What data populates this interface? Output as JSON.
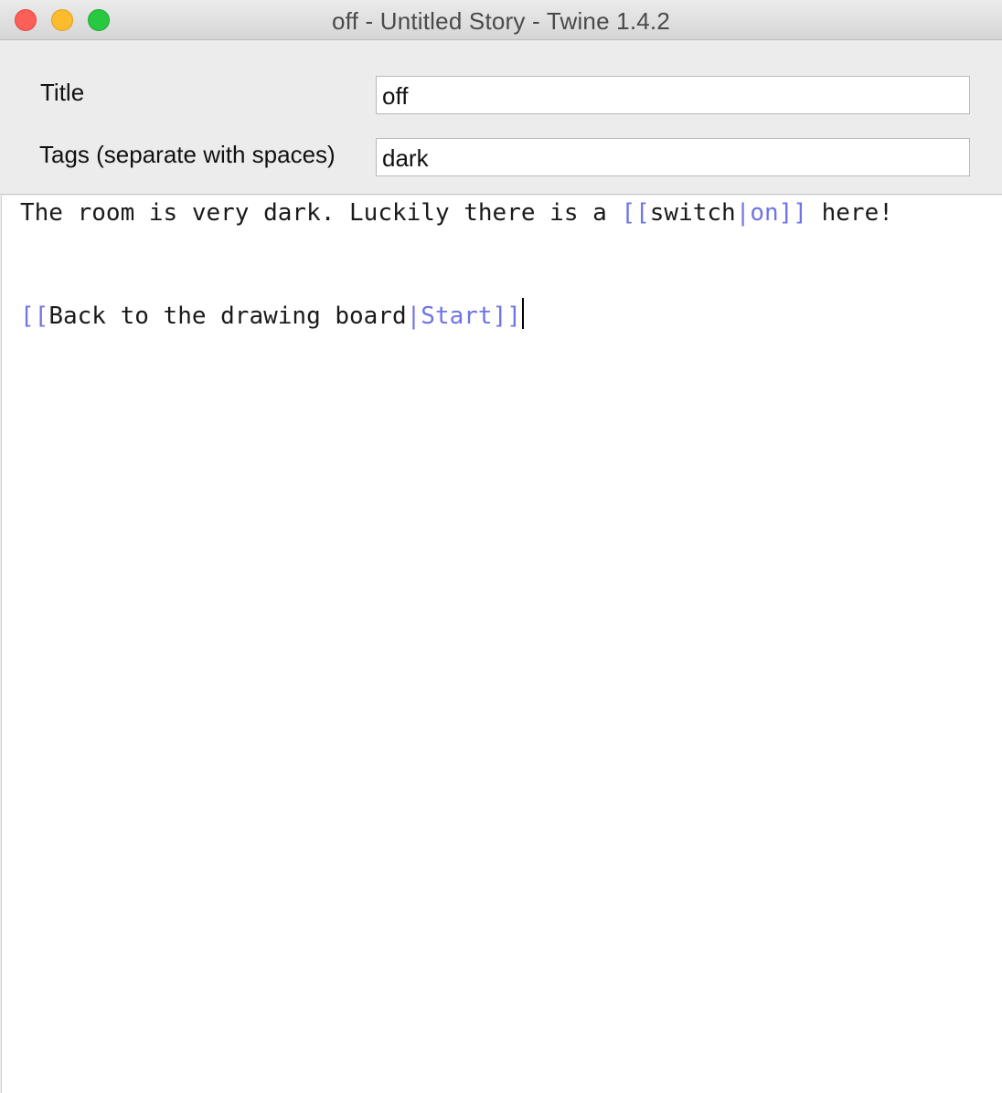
{
  "window": {
    "title": "off - Untitled Story - Twine 1.4.2"
  },
  "form": {
    "title_label": "Title",
    "title_value": "off",
    "tags_label": "Tags (separate with spaces)",
    "tags_value": "dark"
  },
  "editor": {
    "line1": {
      "text_before": "The room is very dark. Luckily there is a ",
      "link_open": "[[",
      "link_text": "switch",
      "link_target": "|on]]",
      "text_after": " here!"
    },
    "line2": {
      "link_open": "[[",
      "link_text": "Back to the drawing board",
      "link_target": "|Start]]"
    }
  },
  "colors": {
    "link": "#6f74e6",
    "close_button": "#fc5f57",
    "minimize_button": "#fdbc2e",
    "maximize_button": "#28c840"
  }
}
